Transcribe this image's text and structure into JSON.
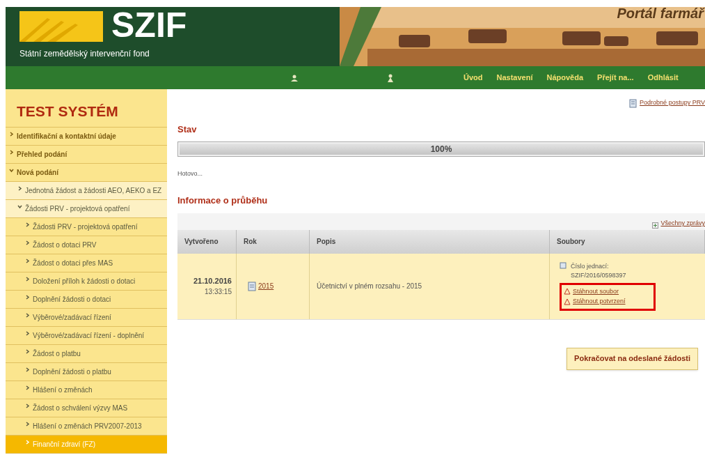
{
  "header": {
    "logo_text": "SZIF",
    "subtitle": "Státní zemědělský intervenční fond",
    "portal_title": "Portál farmář"
  },
  "nav": {
    "links": [
      "Úvod",
      "Nastavení",
      "Nápověda",
      "Přejít na...",
      "Odhlásit"
    ]
  },
  "sidebar": {
    "title": "TEST SYSTÉM",
    "items": [
      {
        "label": "Identifikační a kontaktní údaje",
        "expanded": false,
        "selected": false
      },
      {
        "label": "Přehled podání",
        "expanded": false,
        "selected": false
      },
      {
        "label": "Nová podání",
        "expanded": true,
        "selected": false,
        "children": [
          {
            "label": "Jednotná žádost a žádosti AEO, AEKO a EZ",
            "expanded": false,
            "selected": false
          },
          {
            "label": "Žádosti PRV - projektová opatření",
            "expanded": true,
            "selected": false,
            "children": [
              {
                "label": "Žádosti PRV - projektová opatření",
                "expanded": false,
                "selected": false
              },
              {
                "label": "Žádost o dotaci PRV",
                "expanded": false,
                "selected": false
              },
              {
                "label": "Žádost o dotaci přes MAS",
                "expanded": false,
                "selected": false
              },
              {
                "label": "Doložení příloh k žádosti o dotaci",
                "expanded": false,
                "selected": false
              },
              {
                "label": "Doplnění žádosti o dotaci",
                "expanded": false,
                "selected": false
              },
              {
                "label": "Výběrové/zadávací řízení",
                "expanded": false,
                "selected": false
              },
              {
                "label": "Výběrové/zadávací řízení - doplnění",
                "expanded": false,
                "selected": false
              },
              {
                "label": "Žádost o platbu",
                "expanded": false,
                "selected": false
              },
              {
                "label": "Doplnění žádosti o platbu",
                "expanded": false,
                "selected": false
              },
              {
                "label": "Hlášení o změnách",
                "expanded": false,
                "selected": false
              },
              {
                "label": "Žádost o schválení výzvy MAS",
                "expanded": false,
                "selected": false
              },
              {
                "label": "Hlášení o změnách PRV2007-2013",
                "expanded": false,
                "selected": false
              },
              {
                "label": "Finanční zdraví (FZ)",
                "expanded": false,
                "selected": true
              }
            ]
          }
        ]
      }
    ]
  },
  "main": {
    "top_link": "Podrobné postupy PRV",
    "status_heading": "Stav",
    "progress": {
      "level": 1,
      "reading": "100%"
    },
    "status_text": "Hotovo...",
    "info_heading": "Informace o průběhu",
    "all_messages_link": "Všechny zprávy",
    "table": {
      "columns": [
        "Vytvořeno",
        "Rok",
        "Popis",
        "Soubory"
      ],
      "rows": [
        {
          "date": "21.10.2016",
          "time": "13:33:15",
          "year": "2015",
          "description": "Účetnictví v plném rozsahu - 2015",
          "reference_label": "Číslo jednací:",
          "reference": "SZIF/2016/0598397",
          "files": [
            "Stáhnout soubor",
            "Stáhnout potvrzení"
          ],
          "highlighted": true
        }
      ]
    },
    "continue_button": "Pokračovat na odeslané žádosti"
  }
}
